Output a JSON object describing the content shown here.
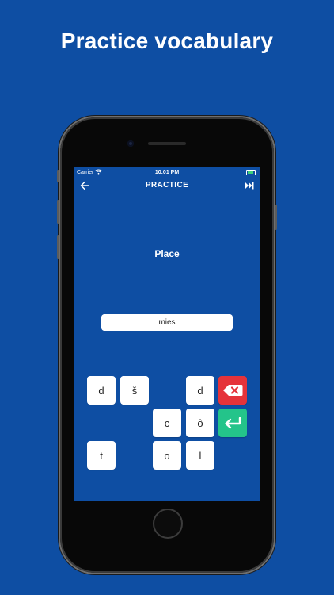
{
  "headline": "Practice vocabulary",
  "status_bar": {
    "carrier": "Carrier",
    "time": "10:01 PM"
  },
  "nav": {
    "title": "PRACTICE",
    "back_icon": "arrow-left-icon",
    "skip_icon": "skip-forward-icon"
  },
  "prompt": {
    "word": "Place"
  },
  "answer": {
    "value": "mies"
  },
  "keyboard": {
    "letters": [
      "d",
      "š",
      "d",
      "c",
      "ô",
      "t",
      "o",
      "l"
    ],
    "delete_icon": "backspace-icon",
    "enter_icon": "enter-icon"
  },
  "colors": {
    "background": "#0e4ea3",
    "delete": "#e5333a",
    "enter": "#24c48a",
    "key": "#ffffff"
  }
}
